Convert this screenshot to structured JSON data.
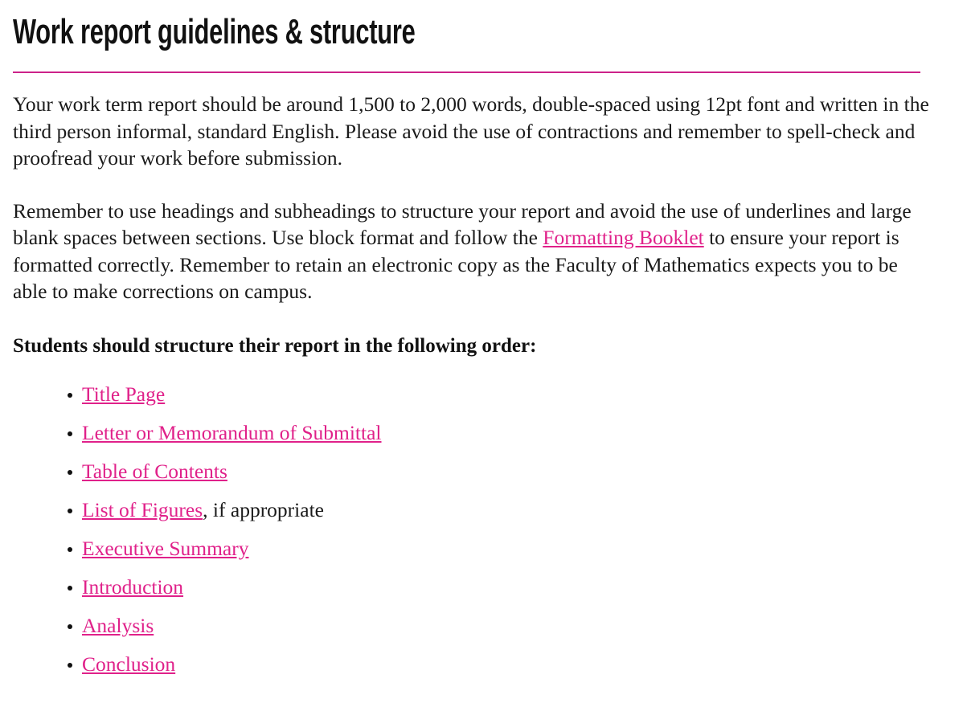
{
  "document": {
    "title": "Work report guidelines & structure",
    "accent_color": "#e0218a",
    "rule_color": "#cc2289",
    "text_color": "#1a1a1a",
    "background_color": "#ffffff"
  },
  "paragraphs": {
    "p1_before": "Your work term report should be around 1,500 to 2,000 words, double-spaced using 12pt font and written in the third person informal, standard English. Please avoid the use of contractions and remember to spell-check and proofread your work before submission.",
    "p2_before": "Remember to use headings and subheadings to structure your report and avoid the use of underlines and large blank spaces between sections. Use block format and follow the ",
    "p2_link": "Formatting Booklet",
    "p2_after": " to ensure your report is formatted correctly. Remember to retain an electronic copy as the Faculty of Mathematics expects you to be able to make corrections on campus."
  },
  "lead_in": "Students should structure their report in the following order:",
  "list": {
    "items": [
      {
        "link": "Title Page",
        "tail": ""
      },
      {
        "link": "Letter or Memorandum of Submittal",
        "tail": ""
      },
      {
        "link": "Table of Contents",
        "tail": ""
      },
      {
        "link": "List of Figures",
        "tail": ", if appropriate"
      },
      {
        "link": "Executive Summary",
        "tail": ""
      },
      {
        "link": "Introduction",
        "tail": ""
      },
      {
        "link": "Analysis",
        "tail": ""
      },
      {
        "link": "Conclusion",
        "tail": ""
      }
    ]
  }
}
